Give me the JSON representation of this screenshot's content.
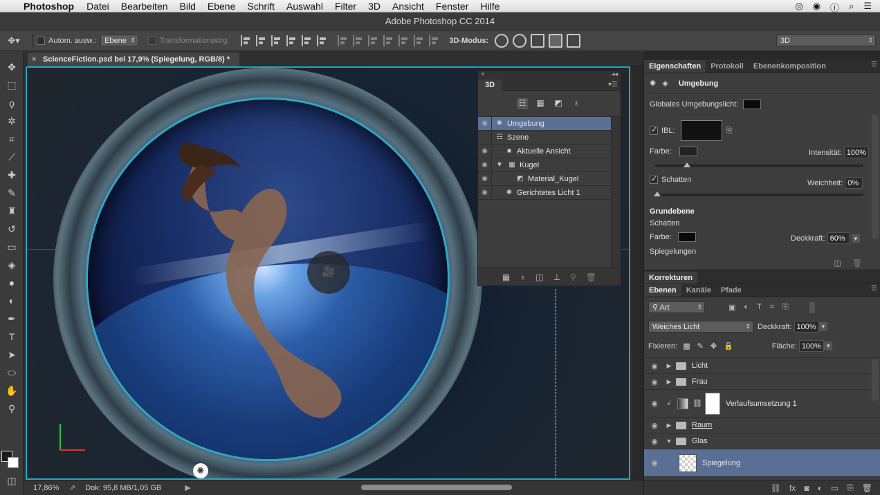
{
  "menubar": {
    "app": "Photoshop",
    "items": [
      "Datei",
      "Bearbeiten",
      "Bild",
      "Ebene",
      "Schrift",
      "Auswahl",
      "Filter",
      "3D",
      "Ansicht",
      "Fenster",
      "Hilfe"
    ]
  },
  "titlebar": {
    "title": "Adobe Photoshop CC 2014"
  },
  "options": {
    "auto_select_label": "Autom. ausw.:",
    "auto_select_value": "Ebene",
    "transform_label": "Transformationsstrg.",
    "mode3d_label": "3D-Modus:",
    "workspace": "3D"
  },
  "document": {
    "tab_title": "ScienceFiction.psd bei 17,9% (Spiegelung, RGB/8) *",
    "zoom": "17,86%",
    "doc_size": "Dok: 95,8 MB/1,05 GB"
  },
  "panel3d": {
    "title": "3D",
    "rows": [
      {
        "label": "Umgebung",
        "selected": true
      },
      {
        "label": "Szene",
        "selected": false
      },
      {
        "label": "Aktuelle Ansicht",
        "selected": false
      },
      {
        "label": "Kugel",
        "selected": false
      },
      {
        "label": "Material_Kugel",
        "selected": false
      },
      {
        "label": "Gerichtetes Licht 1",
        "selected": false
      }
    ]
  },
  "properties": {
    "tabs": [
      "Eigenschaften",
      "Protokoll",
      "Ebenenkomposition"
    ],
    "header": "Umgebung",
    "global_light_label": "Globales Umgebungslicht:",
    "ibl_label": "IBL:",
    "color_label": "Farbe:",
    "intensity_label": "Intensität:",
    "intensity_value": "100%",
    "shadows_label": "Schatten",
    "softness_label": "Weichheit:",
    "softness_value": "0%",
    "ground_label": "Grundebene",
    "ground_shadows_label": "Schatten",
    "ground_color_label": "Farbe:",
    "opacity_label": "Deckkraft:",
    "opacity_value": "60%",
    "reflections_label": "Spiegelungen"
  },
  "korrekturen": {
    "title": "Korrekturen"
  },
  "layers": {
    "tabs": [
      "Ebenen",
      "Kanäle",
      "Pfade"
    ],
    "filter_kind": "Art",
    "blend_mode": "Weiches Licht",
    "opacity_label": "Deckkraft:",
    "opacity_value": "100%",
    "lock_label": "Fixieren:",
    "fill_label": "Fläche:",
    "fill_value": "100%",
    "items": [
      {
        "name": "Licht",
        "type": "group"
      },
      {
        "name": "Frau",
        "type": "group"
      },
      {
        "name": "Verlaufsumsetzung 1",
        "type": "adjustment"
      },
      {
        "name": "Raum",
        "type": "group"
      },
      {
        "name": "Glas",
        "type": "group-open"
      },
      {
        "name": "Spiegelung",
        "type": "layer3d"
      }
    ]
  }
}
